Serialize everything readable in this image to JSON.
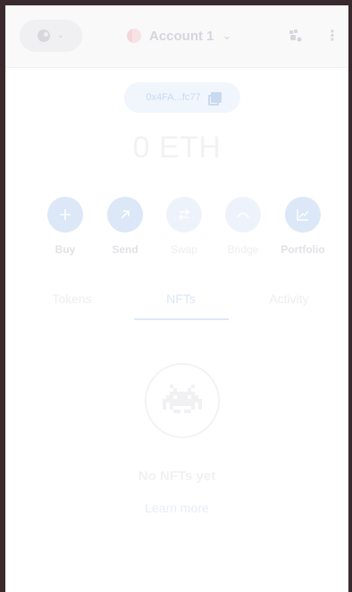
{
  "header": {
    "account_name": "Account 1",
    "network_icon": "network-avatar-icon",
    "connected_icon": "connected-sites-icon",
    "menu_icon": "more-vertical-icon"
  },
  "address": {
    "short": "0x4FA...fc77",
    "copy_icon": "copy-icon"
  },
  "balance": {
    "amount": "0",
    "unit": "ETH"
  },
  "actions": [
    {
      "label": "Buy",
      "icon": "plus-icon"
    },
    {
      "label": "Send",
      "icon": "arrow-up-right-icon"
    },
    {
      "label": "Swap",
      "icon": "swap-arrows-icon"
    },
    {
      "label": "Bridge",
      "icon": "bridge-icon"
    },
    {
      "label": "Portfolio",
      "icon": "chart-icon"
    }
  ],
  "tabs": [
    {
      "label": "Tokens"
    },
    {
      "label": "NFTs"
    },
    {
      "label": "Activity"
    }
  ],
  "empty_state": {
    "title": "No NFTs yet",
    "link": "Learn more",
    "icon": "space-invader-icon"
  },
  "colors": {
    "accent_light": "#dce7f8",
    "header_bg": "#f9f9fa",
    "chip_bg": "#f1f6fd"
  }
}
